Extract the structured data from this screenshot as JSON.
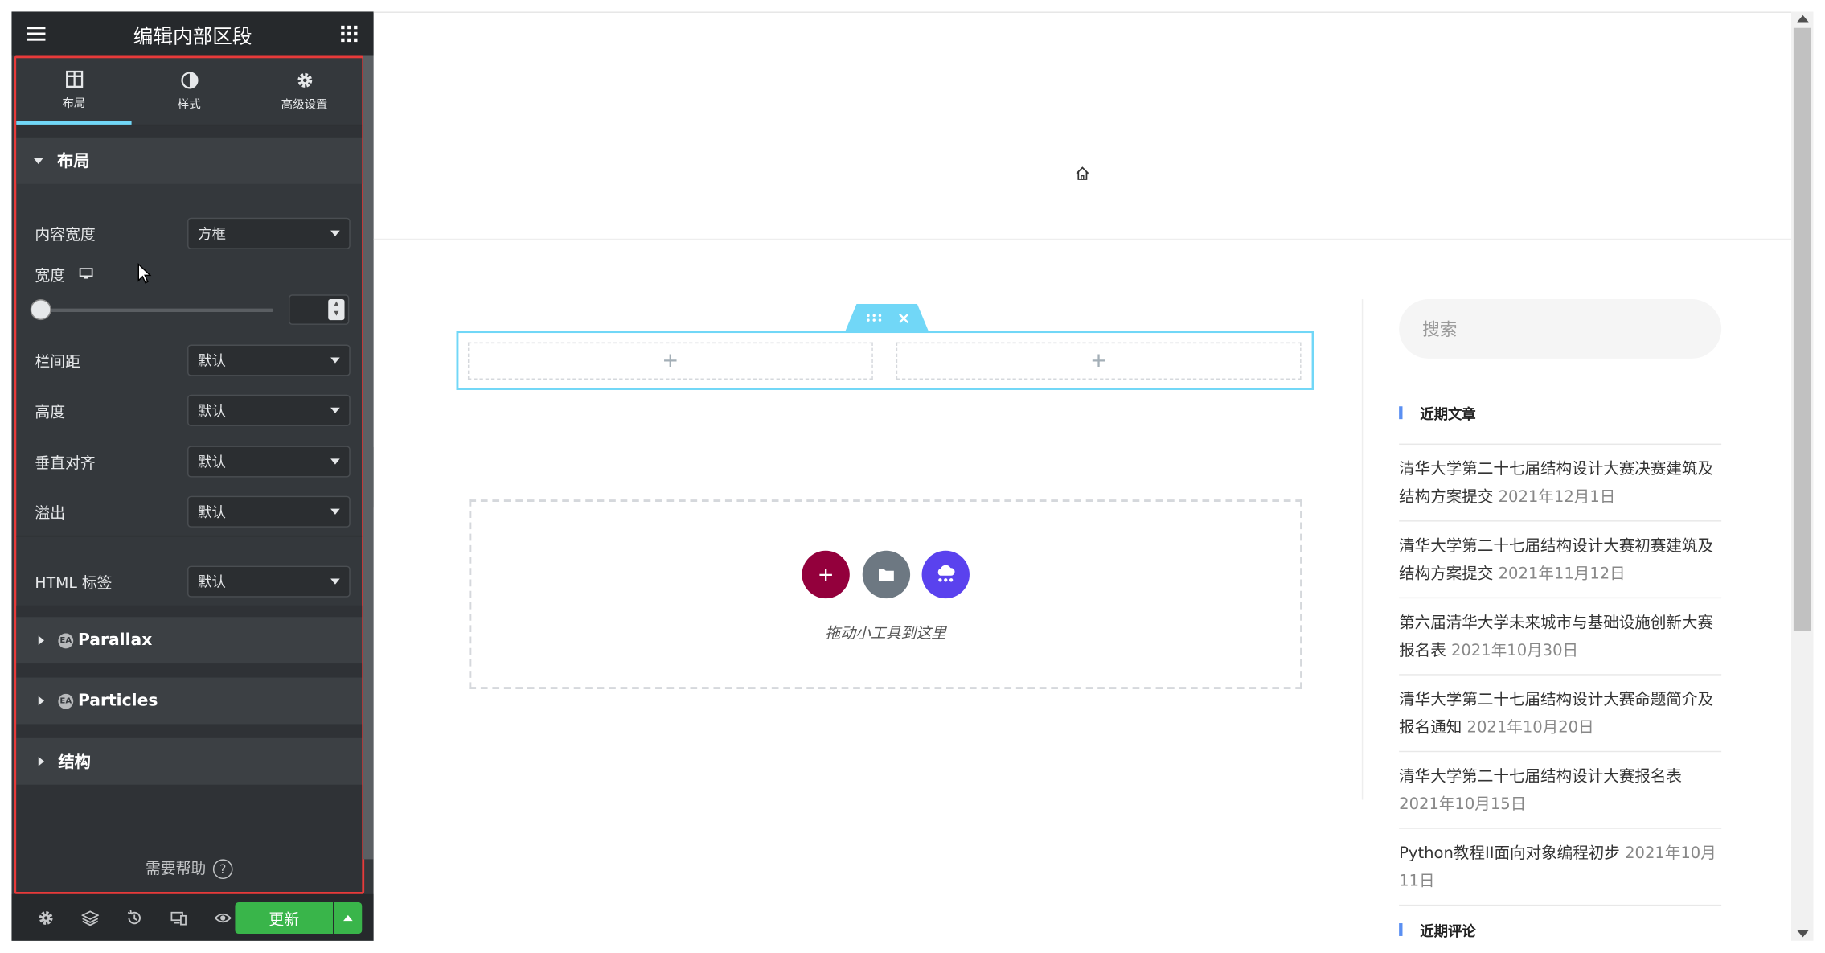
{
  "panel": {
    "title": "编辑内部区段",
    "tabs": [
      {
        "label": "布局",
        "icon": "columns-icon"
      },
      {
        "label": "样式",
        "icon": "half-circle-icon"
      },
      {
        "label": "高级设置",
        "icon": "gear-icon"
      }
    ],
    "layout_section": {
      "title": "布局",
      "content_width_label": "内容宽度",
      "content_width_value": "方框",
      "width_label": "宽度",
      "width_value": "",
      "column_gap_label": "栏间距",
      "column_gap_value": "默认",
      "height_label": "高度",
      "height_value": "默认",
      "vertical_align_label": "垂直对齐",
      "vertical_align_value": "默认",
      "overflow_label": "溢出",
      "overflow_value": "默认",
      "html_tag_label": "HTML 标签",
      "html_tag_value": "默认"
    },
    "collapsed_sections": [
      "Parallax",
      "Particles",
      "结构"
    ],
    "help_text": "需要帮助",
    "update_label": "更新"
  },
  "canvas": {
    "drop_text": "拖动小工具到这里"
  },
  "sidebar": {
    "search_placeholder": "搜索",
    "recent_posts_title": "近期文章",
    "posts": [
      {
        "title": "清华大学第二十七届结构设计大赛决赛建筑及结构方案提交",
        "date": "2021年12月1日"
      },
      {
        "title": "清华大学第二十七届结构设计大赛初赛建筑及结构方案提交",
        "date": "2021年11月12日"
      },
      {
        "title": "第六届清华大学未来城市与基础设施创新大赛报名表",
        "date": "2021年10月30日"
      },
      {
        "title": "清华大学第二十七届结构设计大赛命题简介及报名通知",
        "date": "2021年10月20日"
      },
      {
        "title": "清华大学第二十七届结构设计大赛报名表",
        "date": "2021年10月15日"
      },
      {
        "title": "Python教程II面向对象编程初步",
        "date": "2021年10月11日"
      }
    ],
    "recent_comments_title": "近期评论"
  },
  "colors": {
    "panel_bg": "#34383c",
    "panel_header": "#26292c",
    "accent_blue": "#71d7f7",
    "highlight_red": "#e83a3a",
    "update_green": "#39b54a",
    "add_btn": "#93003c",
    "cloud_btn": "#5a42ee"
  }
}
